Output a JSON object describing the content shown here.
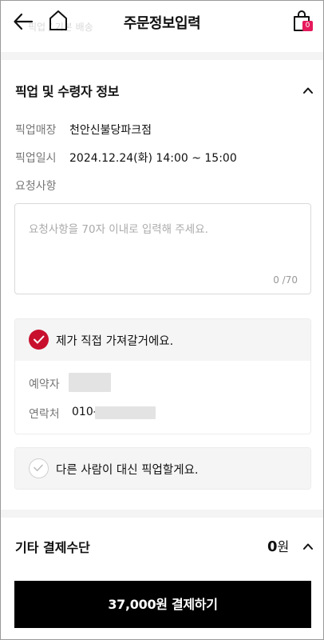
{
  "header": {
    "title": "주문정보입력",
    "ghost_text": "픽업 / 기본 배송",
    "cart_count": "0",
    "accent_color": "#e6195c"
  },
  "pickup_section": {
    "title": "픽업 및 수령자 정보",
    "store_label": "픽업매장",
    "store_value": "천안신불당파크점",
    "datetime_label": "픽업일시",
    "datetime_value": "2024.12.24(화) 14:00 ~ 15:00",
    "request_label": "요청사항",
    "request_placeholder": "요청사항을 70자 이내로 입력해 주세요.",
    "request_counter": "0 /70",
    "self_pickup": {
      "label": "제가 직접 가져갈거에요.",
      "selected": true,
      "reserver_label": "예약자",
      "reserver_value": "",
      "contact_label": "연락처",
      "contact_value": "010-"
    },
    "proxy_pickup": {
      "label": "다른 사람이 대신 픽업할게요.",
      "selected": false
    },
    "check_color": "#c8102e"
  },
  "payment_section": {
    "title": "기타 결제수단",
    "amount": "0",
    "currency": "원"
  },
  "pay_button": {
    "label": "37,000원 결제하기"
  }
}
